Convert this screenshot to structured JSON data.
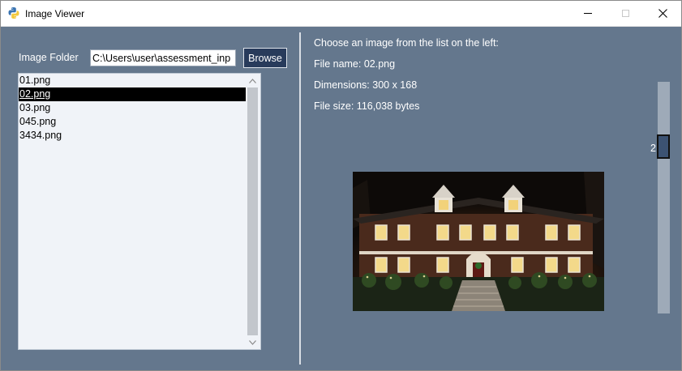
{
  "window": {
    "title": "Image Viewer",
    "icon": "python-icon",
    "controls": {
      "minimize": "minimize-icon",
      "maximize": "maximize-icon",
      "close": "close-icon"
    }
  },
  "folder": {
    "label": "Image Folder",
    "value": "C:\\Users\\user\\assessment_inp",
    "browse_label": "Browse"
  },
  "file_list": {
    "items": [
      {
        "label": "01.png",
        "selected": false
      },
      {
        "label": "02.png",
        "selected": true
      },
      {
        "label": "03.png",
        "selected": false
      },
      {
        "label": "045.png",
        "selected": false
      },
      {
        "label": "3434.png",
        "selected": false
      }
    ]
  },
  "info": {
    "prompt": "Choose an image from the list on the left:",
    "file_name": "File name: 02.png",
    "dimensions": "Dimensions: 300 x 168",
    "file_size": "File size: 116,038 bytes"
  },
  "preview": {
    "subject": "house-at-night-image"
  },
  "slider": {
    "value": "2"
  },
  "colors": {
    "window_bg": "#64778d",
    "button_bg": "#283b5b",
    "list_bg": "#f0f3f8",
    "selection_bg": "#000000",
    "slider_track": "#9eaab8",
    "slider_handle": "#3c5272"
  }
}
